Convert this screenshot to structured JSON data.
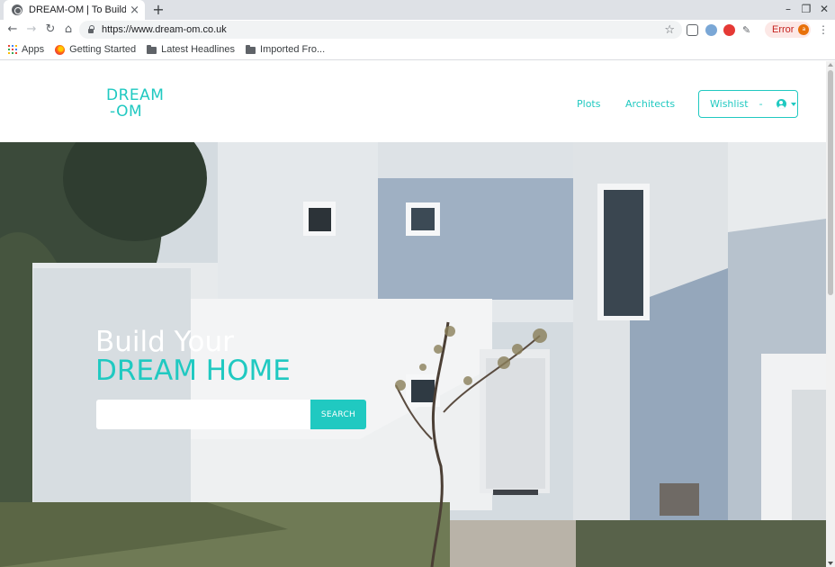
{
  "browser": {
    "tab_title": "DREAM-OM | To Build Your Dream Home",
    "tab_close": "×",
    "new_tab": "+",
    "url": "https://www.dream-om.co.uk",
    "error_label": "Error",
    "profile_initial": "a",
    "bookmarks": [
      {
        "label": "Apps",
        "icon": "apps-grid-icon"
      },
      {
        "label": "Getting Started",
        "icon": "firefox-icon"
      },
      {
        "label": "Latest Headlines",
        "icon": "folder-icon"
      },
      {
        "label": "Imported Fro...",
        "icon": "folder-icon"
      }
    ]
  },
  "site": {
    "logo_line1": "DREAM",
    "logo_line2": "-OM",
    "nav": {
      "plots": "Plots",
      "architects": "Architects"
    },
    "wishlist_label": "Wishlist",
    "wishlist_sep": "-",
    "brand_color": "#20c9c1"
  },
  "hero": {
    "title_line1": "Build Your",
    "title_line2": "DREAM HOME",
    "search_placeholder": "",
    "search_value": "",
    "search_button": "SEARCH"
  }
}
